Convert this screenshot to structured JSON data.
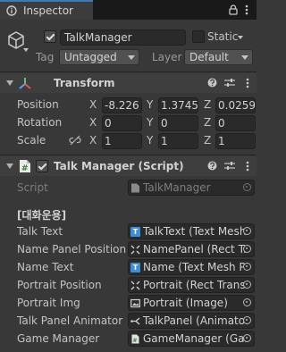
{
  "tab": {
    "label": "Inspector"
  },
  "header": {
    "object_name": "TalkManager",
    "static_label": "Static",
    "tag_label": "Tag",
    "tag_value": "Untagged",
    "layer_label": "Layer",
    "layer_value": "Default"
  },
  "transform": {
    "title": "Transform",
    "rows": [
      {
        "label": "Position",
        "x": "-8.226",
        "y": "1.3745",
        "z": "0.0259"
      },
      {
        "label": "Rotation",
        "x": "0",
        "y": "0",
        "z": "0"
      },
      {
        "label": "Scale",
        "x": "1",
        "y": "1",
        "z": "1"
      }
    ],
    "axis": {
      "x": "X",
      "y": "Y",
      "z": "Z"
    }
  },
  "script_component": {
    "title": "Talk Manager (Script)",
    "script_label": "Script",
    "script_value": "TalkManager",
    "section_header": "[대화운용]",
    "fields": [
      {
        "label": "Talk Text",
        "value": "TalkText (Text Mesh",
        "icon": "text-mesh-icon"
      },
      {
        "label": "Name Panel Position",
        "value": "NamePanel (Rect Tr",
        "icon": "rect-transform-icon"
      },
      {
        "label": "Name Text",
        "value": "Name (Text Mesh P",
        "icon": "text-mesh-icon"
      },
      {
        "label": "Portrait Position",
        "value": "Portrait (Rect Trans",
        "icon": "rect-transform-icon"
      },
      {
        "label": "Portrait Img",
        "value": "Portrait (Image)",
        "icon": "image-icon"
      },
      {
        "label": "Talk Panel Animator",
        "value": "TalkPanel (Animator",
        "icon": "animator-icon"
      },
      {
        "label": "Game Manager",
        "value": "GameManager (Gar",
        "icon": "script-icon"
      }
    ]
  },
  "colors": {
    "background": "#383838",
    "tab_accent": "#3a79bb",
    "field_bg": "#2a2a2a",
    "text_mesh_blue": "#3a8fd8"
  }
}
